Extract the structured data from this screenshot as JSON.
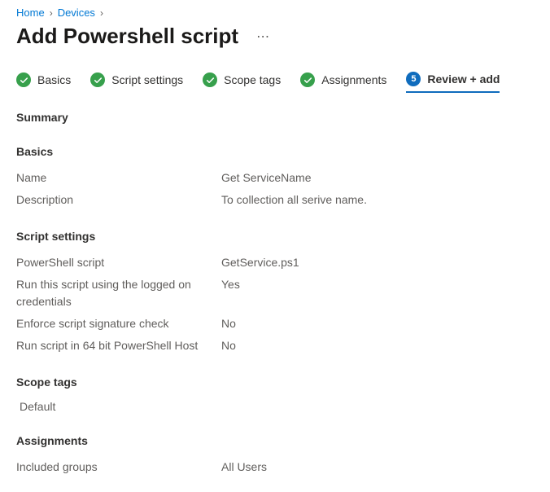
{
  "breadcrumb": {
    "item1": "Home",
    "item2": "Devices"
  },
  "page_title": "Add Powershell script",
  "more_actions": "⋯",
  "wizard": {
    "step1": "Basics",
    "step2": "Script settings",
    "step3": "Scope tags",
    "step4": "Assignments",
    "step5_num": "5",
    "step5": "Review + add"
  },
  "summary_header": "Summary",
  "basics": {
    "header": "Basics",
    "name_label": "Name",
    "name_value": "Get ServiceName",
    "desc_label": "Description",
    "desc_value": "To collection all serive name."
  },
  "script": {
    "header": "Script settings",
    "ps_label": "PowerShell script",
    "ps_value": "GetService.ps1",
    "cred_label": "Run this script using the logged on credentials",
    "cred_value": "Yes",
    "sig_label": "Enforce script signature check",
    "sig_value": "No",
    "host64_label": "Run script in 64 bit PowerShell Host",
    "host64_value": "No"
  },
  "scope": {
    "header": "Scope tags",
    "value": "Default"
  },
  "assignments": {
    "header": "Assignments",
    "inc_label": "Included groups",
    "inc_value": "All Users"
  }
}
